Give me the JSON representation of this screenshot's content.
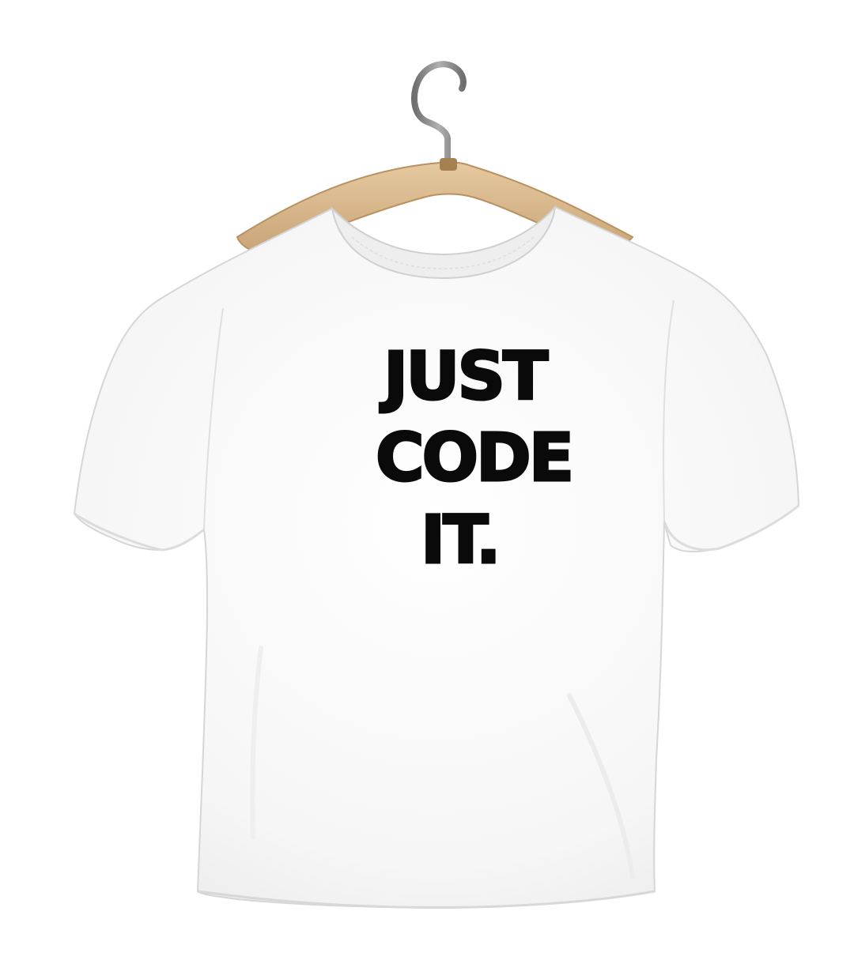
{
  "print": {
    "line1": "JUST",
    "line2": "CODE",
    "line3": "IT."
  },
  "colors": {
    "background": "#ffffff",
    "shirt": "#f7f7f7",
    "shirt_shadow": "#e4e4e4",
    "hanger_wood": "#d9b98a",
    "hanger_hook": "#8a8a8a",
    "print_ink": "#0a0a0a"
  },
  "icons": {
    "hanger": "hanger-icon",
    "shirt": "tshirt-icon"
  }
}
